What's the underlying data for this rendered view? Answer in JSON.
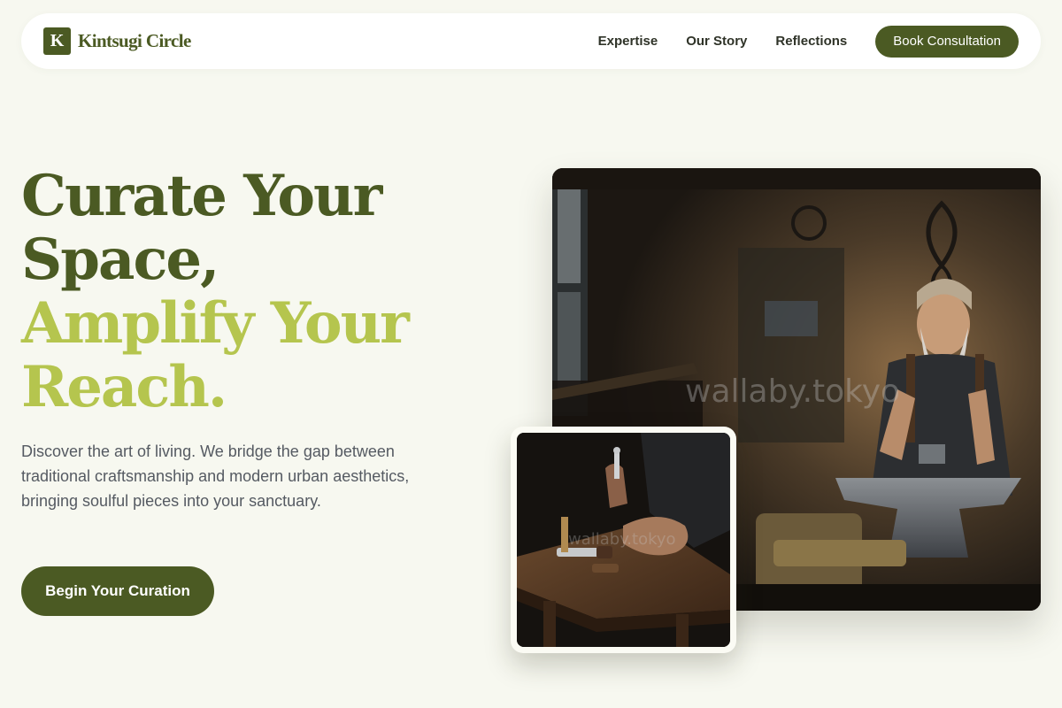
{
  "brand": {
    "mark": "K",
    "name": "Kintsugi Circle"
  },
  "nav": {
    "links": [
      "Expertise",
      "Our Story",
      "Reflections"
    ],
    "cta": "Book Consultation"
  },
  "hero": {
    "title_dark_1": "Curate Your",
    "title_dark_2": "Space,",
    "title_accent_1": "Amplify Your",
    "title_accent_2": "Reach.",
    "description": "Discover the art of living. We bridge the gap between traditional craftsmanship and modern urban aesthetics, bringing soulful pieces into your sanctuary.",
    "cta": "Begin Your Curation"
  },
  "images": {
    "main": {
      "subject": "blacksmith at anvil in workshop",
      "watermark": "wallaby.tokyo"
    },
    "secondary": {
      "subject": "hands working with tools on wooden bench",
      "watermark": "wallaby.tokyo"
    }
  },
  "colors": {
    "background": "#f7f8f0",
    "primary": "#4b5a23",
    "accent": "#b5c54e",
    "body_text": "#555a62"
  }
}
